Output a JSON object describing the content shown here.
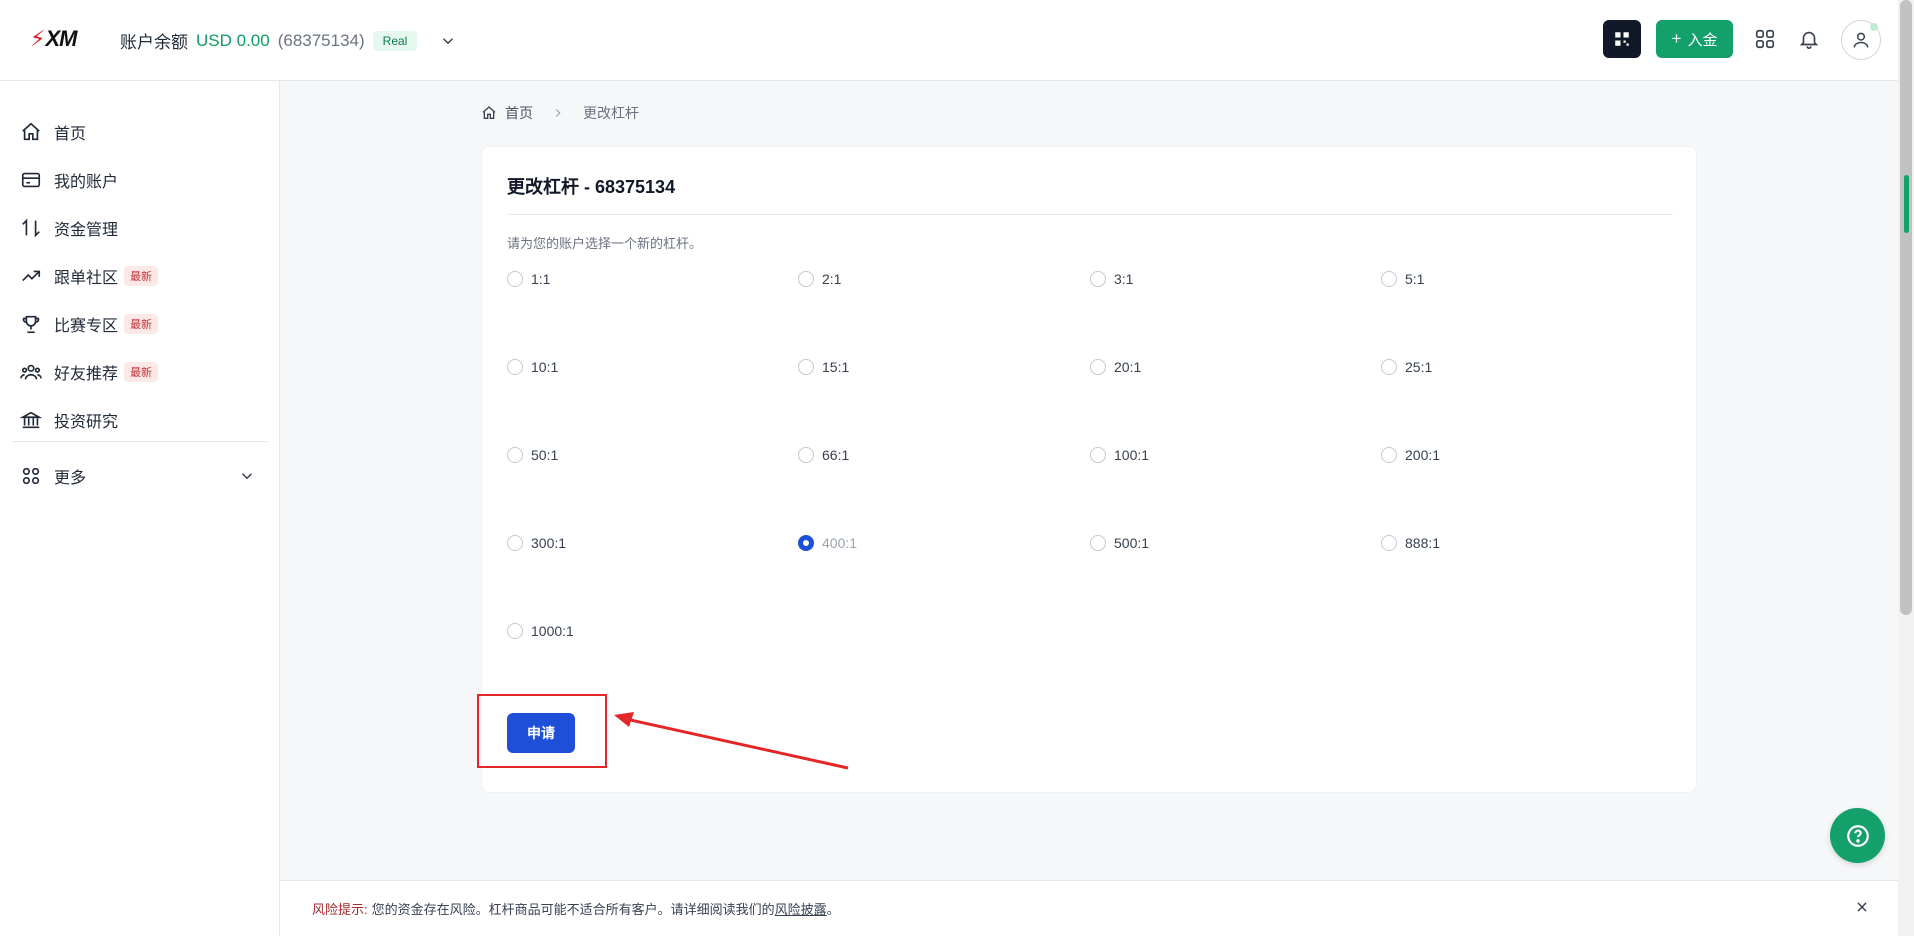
{
  "header": {
    "logo_text": "XM",
    "balance_label": "账户余额",
    "balance_amount": "USD 0.00",
    "account_id": "(68375134)",
    "account_type": "Real",
    "deposit_label": "入金",
    "icons": [
      "qr-code-icon",
      "plus-icon",
      "apps-grid-icon",
      "bell-icon",
      "user-icon"
    ]
  },
  "sidebar": {
    "items": [
      {
        "label": "首页",
        "icon": "home-icon"
      },
      {
        "label": "我的账户",
        "icon": "wallet-icon"
      },
      {
        "label": "资金管理",
        "icon": "transfer-icon"
      },
      {
        "label": "跟单社区",
        "icon": "trending-icon",
        "badge": "最新"
      },
      {
        "label": "比赛专区",
        "icon": "trophy-icon",
        "badge": "最新"
      },
      {
        "label": "好友推荐",
        "icon": "users-icon",
        "badge": "最新"
      },
      {
        "label": "投资研究",
        "icon": "bank-icon"
      }
    ],
    "more_label": "更多"
  },
  "breadcrumb": {
    "home": "首页",
    "current": "更改杠杆"
  },
  "card": {
    "title": "更改杠杆 - 68375134",
    "description": "请为您的账户选择一个新的杠杆。",
    "options": [
      "1:1",
      "2:1",
      "3:1",
      "5:1",
      "10:1",
      "15:1",
      "20:1",
      "25:1",
      "50:1",
      "66:1",
      "100:1",
      "200:1",
      "300:1",
      "400:1",
      "500:1",
      "888:1",
      "1000:1"
    ],
    "selected": "400:1",
    "apply_label": "申请"
  },
  "risk": {
    "warning_label": "风险提示:",
    "text": "您的资金存在风险。杠杆商品可能不适合所有客户。请详细阅读我们的",
    "link": "风险披露",
    "end": "。"
  },
  "colors": {
    "primary_blue": "#1d4fd8",
    "green": "#14a06b",
    "annotation_red": "#e32626"
  }
}
